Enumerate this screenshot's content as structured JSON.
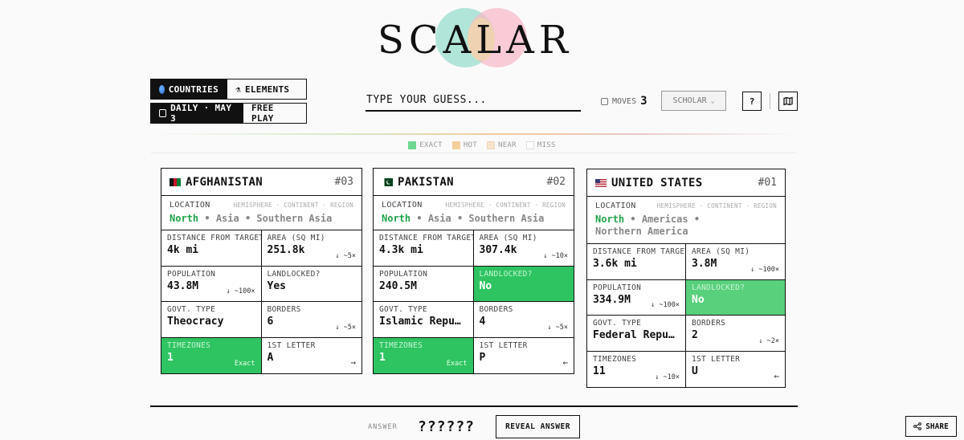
{
  "app": {
    "title": "SCALAR"
  },
  "modes": {
    "countries_label": "COUNTRIES",
    "elements_label": "ELEMENTS",
    "daily_label": "DAILY · MAY 3",
    "free_play_label": "FREE PLAY"
  },
  "guess": {
    "placeholder": "TYPE YOUR GUESS..."
  },
  "moves": {
    "label": "MOVES",
    "value": "3"
  },
  "difficulty": {
    "selected": "SCHOLAR"
  },
  "help_label": "?",
  "legend": [
    {
      "label": "EXACT",
      "color": "#6fd890"
    },
    {
      "label": "HOT",
      "color": "#f4cf98"
    },
    {
      "label": "NEAR",
      "color": "#f8e3cc"
    },
    {
      "label": "MISS",
      "color": "#ffffff"
    }
  ],
  "location_header": {
    "label": "LOCATION",
    "sub": "HEMISPHERE · CONTINENT · REGION"
  },
  "cards": [
    {
      "name": "AFGHANISTAN",
      "number": "#03",
      "hemisphere": "North",
      "continent": "Asia",
      "region": "Southern Asia",
      "cells": [
        {
          "label": "DISTANCE FROM TARGET",
          "value": "4k mi",
          "hint": ""
        },
        {
          "label": "AREA (SQ MI)",
          "value": "251.8k",
          "hint": "↓ ~5×"
        },
        {
          "label": "POPULATION",
          "value": "43.8M",
          "hint": "↓ ~100×"
        },
        {
          "label": "LANDLOCKED?",
          "value": "Yes",
          "hint": ""
        },
        {
          "label": "GOVT. TYPE",
          "value": "Theocracy",
          "hint": ""
        },
        {
          "label": "BORDERS",
          "value": "6",
          "hint": "↓ ~5×"
        },
        {
          "label": "TIMEZONES",
          "value": "1",
          "hint": "Exact"
        },
        {
          "label": "1ST LETTER",
          "value": "A",
          "hint": "→"
        }
      ]
    },
    {
      "name": "PAKISTAN",
      "number": "#02",
      "hemisphere": "North",
      "continent": "Asia",
      "region": "Southern Asia",
      "cells": [
        {
          "label": "DISTANCE FROM TARGET",
          "value": "4.3k mi",
          "hint": ""
        },
        {
          "label": "AREA (SQ MI)",
          "value": "307.4k",
          "hint": "↓ ~10×"
        },
        {
          "label": "POPULATION",
          "value": "240.5M",
          "hint": ""
        },
        {
          "label": "LANDLOCKED?",
          "value": "No",
          "hint": ""
        },
        {
          "label": "GOVT. TYPE",
          "value": "Islamic Republic",
          "hint": ""
        },
        {
          "label": "BORDERS",
          "value": "4",
          "hint": "↓ ~5×"
        },
        {
          "label": "TIMEZONES",
          "value": "1",
          "hint": "Exact"
        },
        {
          "label": "1ST LETTER",
          "value": "P",
          "hint": "←"
        }
      ]
    },
    {
      "name": "UNITED STATES",
      "number": "#01",
      "hemisphere": "North",
      "continent": "Americas",
      "region": "Northern America",
      "cells": [
        {
          "label": "DISTANCE FROM TARGET",
          "value": "3.6k mi",
          "hint": ""
        },
        {
          "label": "AREA (SQ MI)",
          "value": "3.8M",
          "hint": "↓ ~100×"
        },
        {
          "label": "POPULATION",
          "value": "334.9M",
          "hint": "↓ ~100×"
        },
        {
          "label": "LANDLOCKED?",
          "value": "No",
          "hint": ""
        },
        {
          "label": "GOVT. TYPE",
          "value": "Federal Republic",
          "hint": ""
        },
        {
          "label": "BORDERS",
          "value": "2",
          "hint": "↓ ~2×"
        },
        {
          "label": "TIMEZONES",
          "value": "11",
          "hint": "↓ ~10×"
        },
        {
          "label": "1ST LETTER",
          "value": "U",
          "hint": "←"
        }
      ]
    }
  ],
  "answer": {
    "label": "ANSWER",
    "value": "??????",
    "reveal_label": "REVEAL ANSWER"
  },
  "share_label": "SHARE"
}
